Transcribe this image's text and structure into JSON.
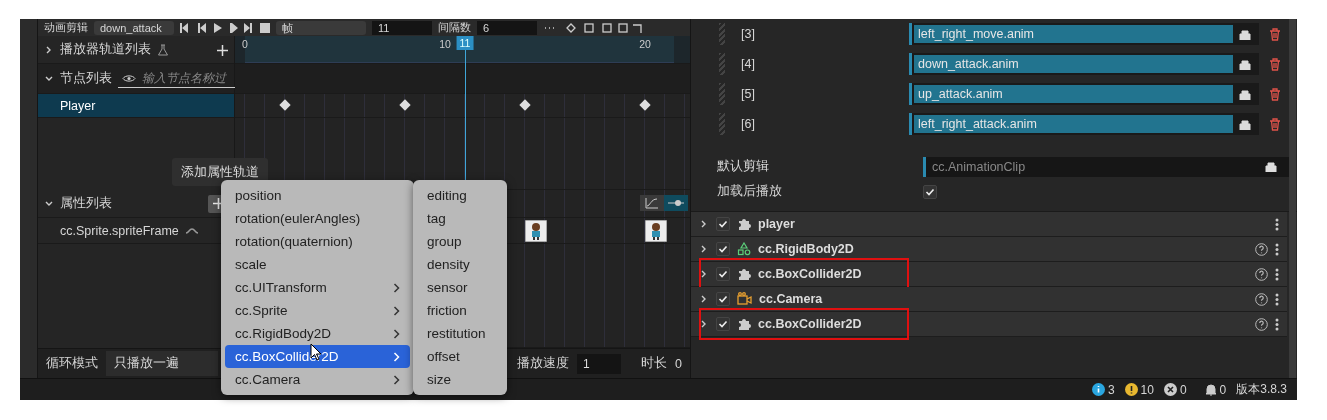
{
  "toolbar": {
    "clip_label": "动画剪辑",
    "clip": "down_attack",
    "frame_mode": "帧",
    "frame": "11",
    "interval_label": "间隔数",
    "interval": "6"
  },
  "player_tracks": {
    "label": "播放器轨道列表",
    "expanded": false
  },
  "node_list": {
    "label": "节点列表",
    "expanded": true,
    "placeholder": "输入节点名称过"
  },
  "nodes": [
    {
      "label": "Player",
      "selected": true
    }
  ],
  "timeline": {
    "ticks": [
      "0",
      "10",
      "20"
    ],
    "playhead": "11"
  },
  "tooltip": "添加属性轨道",
  "property_list": {
    "label": "属性列表",
    "expanded": true
  },
  "properties": [
    {
      "label": "cc.Sprite.spriteFrame"
    }
  ],
  "menu": {
    "items": [
      {
        "label": "position",
        "submenu": false,
        "selected": false
      },
      {
        "label": "rotation(eulerAngles)",
        "submenu": false,
        "selected": false
      },
      {
        "label": "rotation(quaternion)",
        "submenu": false,
        "selected": false
      },
      {
        "label": "scale",
        "submenu": false,
        "selected": false
      },
      {
        "label": "cc.UITransform",
        "submenu": true,
        "selected": false
      },
      {
        "label": "cc.Sprite",
        "submenu": true,
        "selected": false
      },
      {
        "label": "cc.RigidBody2D",
        "submenu": true,
        "selected": false
      },
      {
        "label": "cc.BoxCollider2D",
        "submenu": true,
        "selected": true
      },
      {
        "label": "cc.Camera",
        "submenu": true,
        "selected": false
      }
    ],
    "submenu": [
      "editing",
      "tag",
      "group",
      "density",
      "sensor",
      "friction",
      "restitution",
      "offset",
      "size"
    ]
  },
  "loop": {
    "label": "循环模式",
    "value": "只播放一遍"
  },
  "speed": {
    "label": "播放速度",
    "value": "1"
  },
  "duration": {
    "label": "时长",
    "value": "0"
  },
  "inspector": {
    "clips": [
      {
        "index": "[3]",
        "value": "left_right_move.anim"
      },
      {
        "index": "[4]",
        "value": "down_attack.anim"
      },
      {
        "index": "[5]",
        "value": "up_attack.anim"
      },
      {
        "index": "[6]",
        "value": "left_right_attack.anim"
      }
    ],
    "default_clip": {
      "label": "默认剪辑",
      "placeholder": "cc.AnimationClip"
    },
    "play_on_load": {
      "label": "加载后播放",
      "checked": true
    },
    "components": [
      {
        "name": "player",
        "kind": "script",
        "checked": true,
        "help": false,
        "highlighted": false
      },
      {
        "name": "cc.RigidBody2D",
        "kind": "rigidbody",
        "checked": true,
        "help": true,
        "highlighted": false
      },
      {
        "name": "cc.BoxCollider2D",
        "kind": "script",
        "checked": true,
        "help": true,
        "highlighted": true
      },
      {
        "name": "cc.Camera",
        "kind": "camera",
        "checked": true,
        "help": true,
        "highlighted": false
      },
      {
        "name": "cc.BoxCollider2D",
        "kind": "script",
        "checked": true,
        "help": true,
        "highlighted": true
      }
    ]
  },
  "status": {
    "info": "3",
    "warnings": "10",
    "errors": "0",
    "notifications": "0",
    "version": "版本3.8.3"
  }
}
